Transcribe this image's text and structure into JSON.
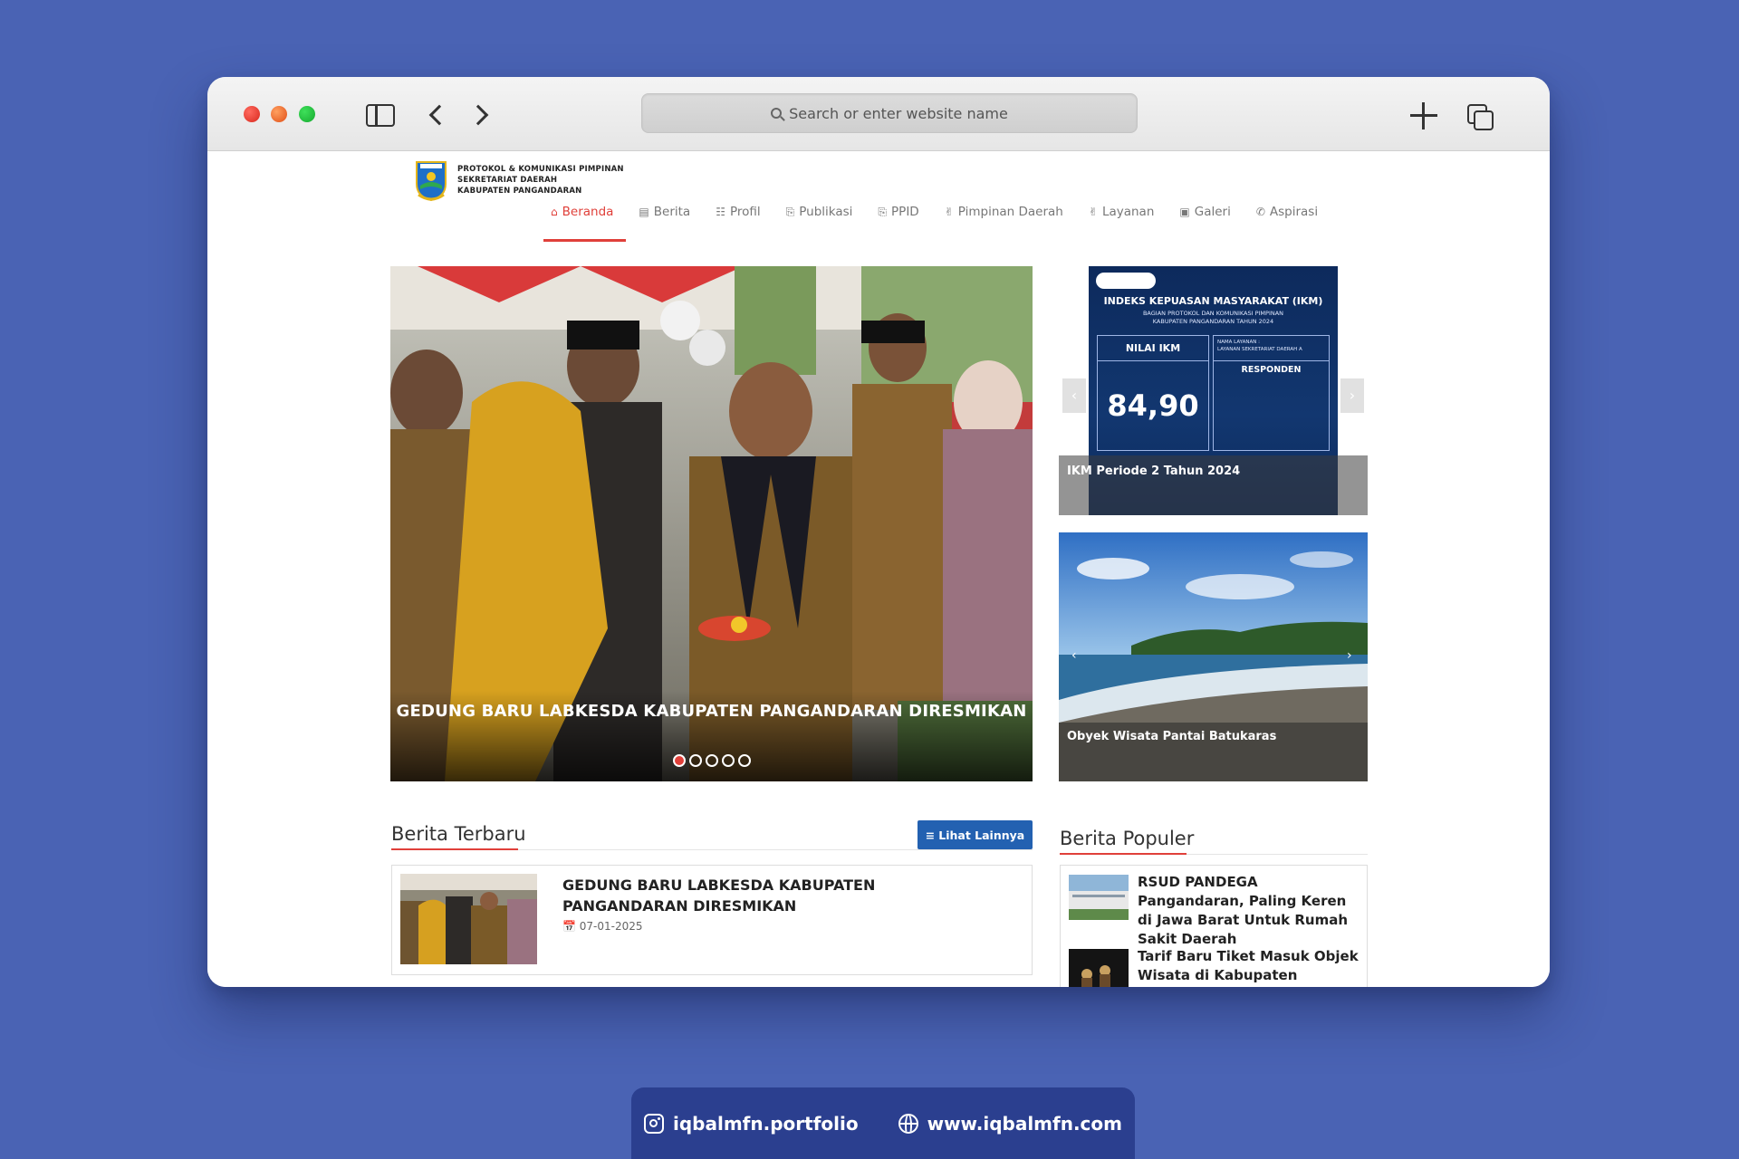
{
  "browser": {
    "url_placeholder": "Search or enter website name"
  },
  "site": {
    "title_lines": [
      "PROTOKOL & KOMUNIKASI PIMPINAN",
      "SEKRETARIAT DAERAH",
      "KABUPATEN PANGANDARAN"
    ]
  },
  "nav": {
    "items": [
      {
        "label": "Beranda",
        "icon": "home-icon",
        "active": true
      },
      {
        "label": "Berita",
        "icon": "newspaper-icon"
      },
      {
        "label": "Profil",
        "icon": "institution-icon"
      },
      {
        "label": "Publikasi",
        "icon": "document-icon"
      },
      {
        "label": "PPID",
        "icon": "document-icon"
      },
      {
        "label": "Pimpinan Daerah",
        "icon": "thumbs-up-icon"
      },
      {
        "label": "Layanan",
        "icon": "thumbs-up-icon"
      },
      {
        "label": "Galeri",
        "icon": "image-icon"
      },
      {
        "label": "Aspirasi",
        "icon": "phone-icon"
      }
    ]
  },
  "hero": {
    "caption": "GEDUNG BARU LABKESDA KABUPATEN PANGANDARAN DIRESMIKAN",
    "slide_count": 5,
    "active_slide": 1
  },
  "ikm": {
    "poster_title": "INDEKS KEPUASAN MASYARAKAT (IKM)",
    "poster_sub_1": "BAGIAN PROTOKOL DAN KOMUNIKASI PIMPINAN",
    "poster_sub_2": "KABUPATEN PANGANDARAN TAHUN 2024",
    "nilai_label": "NILAI IKM",
    "score": "84,90",
    "layanan_label": "NAMA LAYANAN :",
    "layanan_value": "LAYANAN SEKRETARIAT DAERAH A",
    "responden_label": "RESPONDEN",
    "caption": "IKM Periode 2 Tahun 2024"
  },
  "beach": {
    "caption": "Obyek Wisata Pantai Batukaras"
  },
  "berita_terbaru": {
    "title": "Berita Terbaru",
    "button": "Lihat Lainnya",
    "items": [
      {
        "title": "GEDUNG BARU LABKESDA KABUPATEN PANGANDARAN DIRESMIKAN",
        "date": "07-01-2025"
      }
    ]
  },
  "berita_populer": {
    "title": "Berita Populer",
    "items": [
      {
        "title": "RSUD PANDEGA Pangandaran, Paling Keren di Jawa Barat Untuk Rumah Sakit Daerah"
      },
      {
        "title": "Tarif Baru Tiket Masuk Objek Wisata di Kabupaten"
      }
    ]
  },
  "footer": {
    "instagram": "iqbalmfn.portfolio",
    "website": "www.iqbalmfn.com"
  }
}
